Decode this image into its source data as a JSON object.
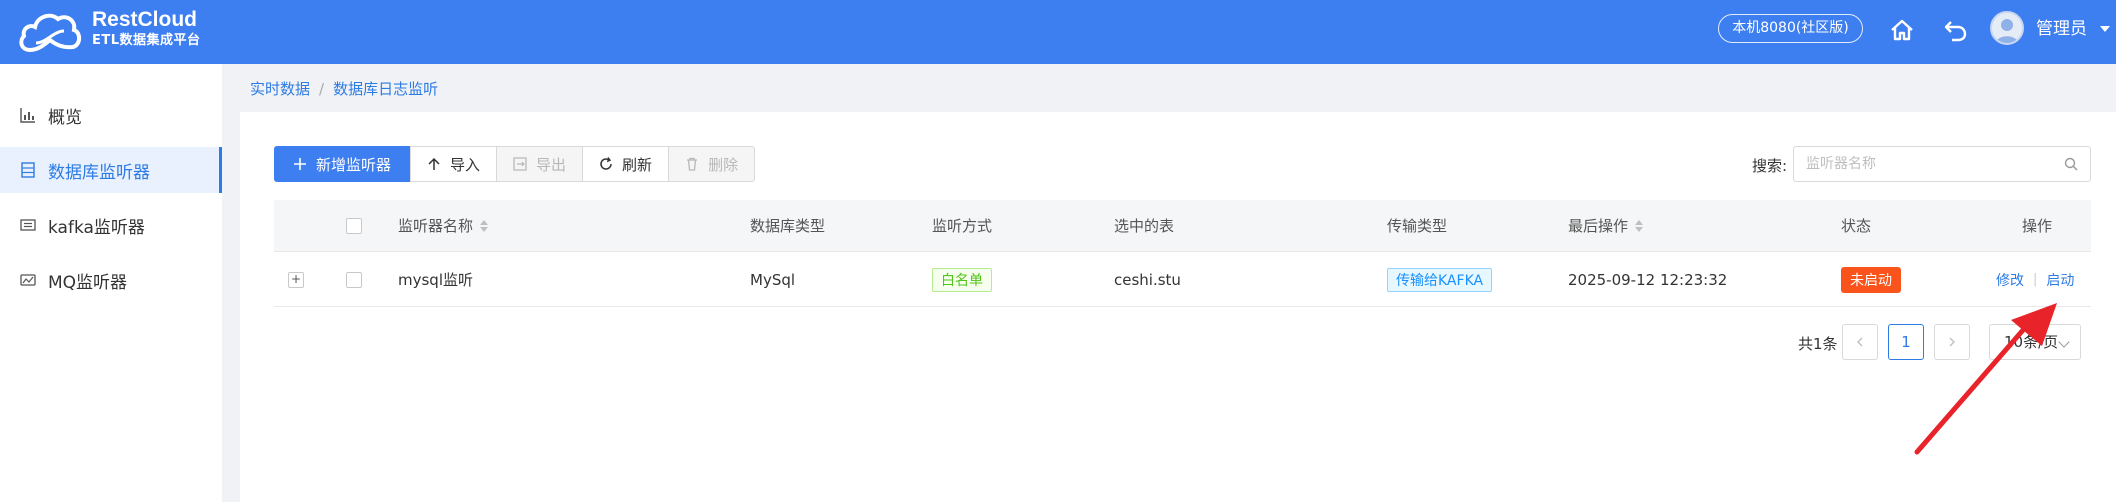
{
  "header": {
    "brand_name": "RestCloud",
    "brand_sub": "ETL数据集成平台",
    "env_label": "本机8080(社区版)",
    "user_name": "管理员",
    "icons": [
      "cloud-logo",
      "home-icon",
      "undo-icon",
      "avatar",
      "caret-down-icon"
    ]
  },
  "sidebar": {
    "items": [
      {
        "label": "概览",
        "icon": "chart-icon",
        "active": false
      },
      {
        "label": "数据库监听器",
        "icon": "database-icon",
        "active": true
      },
      {
        "label": "kafka监听器",
        "icon": "kafka-icon",
        "active": false
      },
      {
        "label": "MQ监听器",
        "icon": "mq-icon",
        "active": false
      }
    ]
  },
  "breadcrumb": [
    "实时数据",
    "数据库日志监听"
  ],
  "toolbar": {
    "add_label": "新增监听器",
    "import_label": "导入",
    "export_label": "导出",
    "refresh_label": "刷新",
    "delete_label": "删除"
  },
  "search": {
    "label": "搜索:",
    "placeholder": "监听器名称"
  },
  "table": {
    "columns": [
      "监听器名称",
      "数据库类型",
      "监听方式",
      "选中的表",
      "传输类型",
      "最后操作",
      "状态",
      "操作"
    ],
    "rows": [
      {
        "expand": "+",
        "name": "mysql监听",
        "db_type": "MySql",
        "mode": "白名单",
        "tables": "ceshi.stu",
        "transfer": "传输给KAFKA",
        "last_op": "2025-09-12 12:23:32",
        "status": "未启动",
        "action_edit": "修改",
        "action_start": "启动"
      }
    ]
  },
  "pagination": {
    "total": "共1条",
    "current_page": "1",
    "page_size": "10条/页"
  },
  "colors": {
    "header_bg": "#3d7ef0",
    "accent": "#2d7be5",
    "status_bg": "#fa541c",
    "annotation_arrow": "#e8242a"
  }
}
